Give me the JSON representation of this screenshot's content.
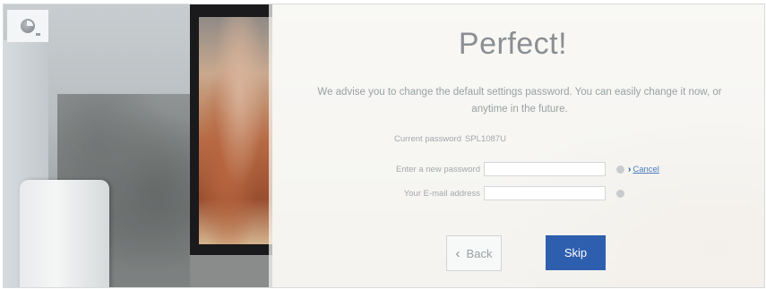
{
  "brand": {
    "logo_icon": "router-brand-logo-icon"
  },
  "header": {
    "title": "Perfect!"
  },
  "message": {
    "advice": "We advise you to change the default settings password. You can easily change it now, or anytime in the future."
  },
  "form": {
    "current_password_label": "Current password",
    "current_password_value": "SPL1087U",
    "new_password_label": "Enter a new password",
    "new_password_value": "",
    "email_label": "Your E-mail address",
    "email_value": "",
    "info_icon": "info-dot-icon",
    "cancel_label": "Cancel"
  },
  "buttons": {
    "back_label": "Back",
    "back_icon": "chevron-left-icon",
    "skip_label": "Skip"
  },
  "colors": {
    "accent": "#2e5eae",
    "link": "#4a7cc2",
    "title_text": "#8a8f93"
  }
}
